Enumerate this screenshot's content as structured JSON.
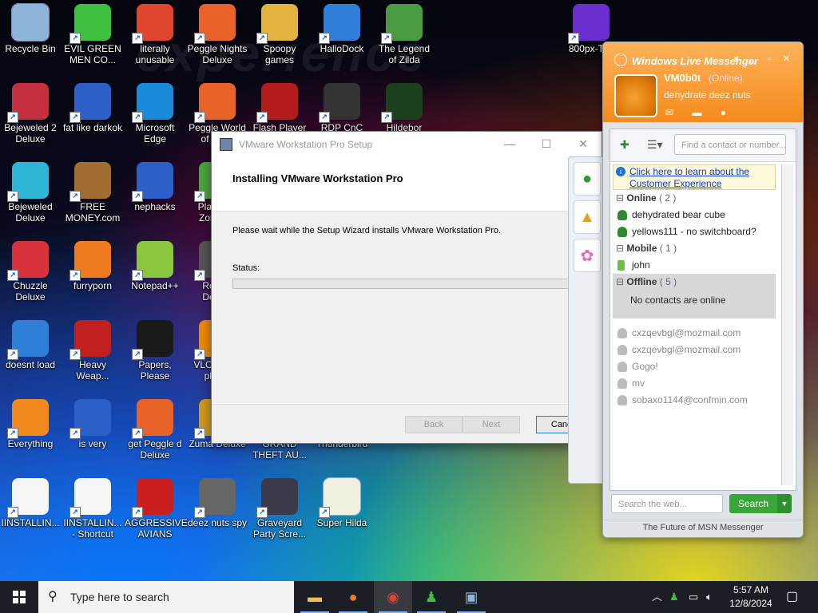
{
  "desktop": {
    "watermark": "experience",
    "icons": [
      {
        "label": "Recycle Bin",
        "icon": "recycle-bin-icon",
        "color": "#8fb4d9",
        "selected": true
      },
      {
        "label": "EVIL GREEN MEN CO...",
        "icon": "msn-buddies-icon",
        "color": "#3fbf3f"
      },
      {
        "label": "literally unusable",
        "icon": "chrome-icon",
        "color": "#e0452d"
      },
      {
        "label": "Peggle Nights Deluxe",
        "icon": "peggle-icon",
        "color": "#e8622a"
      },
      {
        "label": "Spoopy games",
        "icon": "folder-icon",
        "color": "#e4b23f"
      },
      {
        "label": "HalloDock",
        "icon": "shield-icon",
        "color": "#2f7fd8"
      },
      {
        "label": "The Legend of Zilda",
        "icon": "game-character-icon",
        "color": "#4a9a42"
      },
      {
        "label": "800px-Ti...",
        "icon": "image-file-icon",
        "color": "#6b2fd0"
      },
      {
        "label": "Bejeweled 2 Deluxe",
        "icon": "bejeweled-icon",
        "color": "#c4303d"
      },
      {
        "label": "fat like darkok",
        "icon": "mpi-icon",
        "color": "#2d5fc9"
      },
      {
        "label": "Microsoft Edge",
        "icon": "edge-icon",
        "color": "#1a8bd9"
      },
      {
        "label": "Peggle World of Wa...",
        "icon": "peggle-icon",
        "color": "#e8622a"
      },
      {
        "label": "Flash Player",
        "icon": "flash-icon",
        "color": "#b31c1c"
      },
      {
        "label": "RDP CnC",
        "icon": "remote-desktop-icon",
        "color": "#333333"
      },
      {
        "label": "Hildebor",
        "icon": "yashma-icon",
        "color": "#1c3f1c"
      },
      {
        "label": "Bejeweled Deluxe",
        "icon": "gem-icon",
        "color": "#2fb6d6"
      },
      {
        "label": "FREE MONEY.com",
        "icon": "money-bag-icon",
        "color": "#a06c2f"
      },
      {
        "label": "nephacks",
        "icon": "mpi-icon",
        "color": "#2d5fc9"
      },
      {
        "label": "Plants vs Zombies",
        "icon": "plant-icon",
        "color": "#4aa83a"
      },
      {
        "label": "Chuzzle Deluxe",
        "icon": "chuzzle-icon",
        "color": "#d8323a"
      },
      {
        "label": "furryporn",
        "icon": "firefox-icon",
        "color": "#f07a1e"
      },
      {
        "label": "Notepad++",
        "icon": "notepad-icon",
        "color": "#8cc63f"
      },
      {
        "label": "Rocket Deluxe",
        "icon": "rocket-icon",
        "color": "#555555"
      },
      {
        "label": "doesnt load",
        "icon": "thunderbird-icon",
        "color": "#2f7fd8"
      },
      {
        "label": "Heavy Weap...",
        "icon": "radiation-icon",
        "color": "#c21f1f"
      },
      {
        "label": "Papers, Please",
        "icon": "papers-please-icon",
        "color": "#1a1a1a"
      },
      {
        "label": "VLC media player",
        "icon": "vlc-icon",
        "color": "#f08a00"
      },
      {
        "label": "Everything",
        "icon": "search-ring-icon",
        "color": "#f08a1e"
      },
      {
        "label": "is very",
        "icon": "mpi-icon",
        "color": "#2d5fc9"
      },
      {
        "label": "get Peggle d Deluxe",
        "icon": "peggle-icon",
        "color": "#e8622a"
      },
      {
        "label": "Zuma Deluxe",
        "icon": "zuma-icon",
        "color": "#d39a1e"
      },
      {
        "label": "GRAND THEFT AU...",
        "icon": "gta-icon",
        "color": "#222222"
      },
      {
        "label": "Thunderbird",
        "icon": "thunderbird-icon",
        "color": "#2f7fd8"
      },
      {
        "label": "IINSTALLIN...",
        "icon": "text-file-icon",
        "color": "#f5f5f5"
      },
      {
        "label": "IINSTALLIN... - Shortcut",
        "icon": "text-file-icon",
        "color": "#f5f5f5"
      },
      {
        "label": "AGGRESSIVE AVIANS",
        "icon": "angry-bird-icon",
        "color": "#c91f1f"
      },
      {
        "label": "deez nuts spy",
        "icon": "stacked-windows-icon",
        "color": "#666666"
      },
      {
        "label": "Graveyard Party Scre...",
        "icon": "graveyard-icon",
        "color": "#3a3a4a"
      },
      {
        "label": "Super Hilda",
        "icon": "pixel-art-icon",
        "color": "#f0f0e0",
        "selected": true
      }
    ]
  },
  "setup": {
    "title": "VMware Workstation Pro Setup",
    "heading": "Installing VMware Workstation Pro",
    "message": "Please wait while the Setup Wizard installs VMware Workstation Pro.",
    "status_label": "Status:",
    "progress": 0,
    "buttons": {
      "back": "Back",
      "next": "Next",
      "cancel": "Cancel"
    },
    "window_controls": {
      "minimize": "—",
      "maximize": "☐",
      "close": "✕"
    }
  },
  "msn": {
    "brand": "Windows Live Messenger",
    "user": {
      "name": "VM0b0t",
      "status": "(Online)",
      "personal_message": "dehydrate deez nuts"
    },
    "search_contacts_placeholder": "Find a contact or number...",
    "banner": "Click here to learn about the Customer Experience",
    "groups": {
      "online": {
        "label": "Online",
        "count": "( 2 )",
        "contacts": [
          "dehydrated bear cube",
          "yellows111 - no switchboard?"
        ]
      },
      "mobile": {
        "label": "Mobile",
        "count": "( 1 )",
        "contacts": [
          "john"
        ]
      },
      "offline": {
        "label": "Offline",
        "count": "( 5 )",
        "empty_text": "No contacts are online",
        "contacts": [
          "cxzqevbgl@mozmail.com",
          "cxzqevbgl@mozmail.com",
          "Gogo!",
          "mv",
          "sobaxo1144@confmin.com"
        ]
      }
    },
    "web_search_placeholder": "Search the web...",
    "search_button": "Search",
    "footer": "The Future of MSN Messenger"
  },
  "taskbar": {
    "search_placeholder": "Type here to search",
    "apps": [
      "file-explorer-icon",
      "firefox-icon",
      "chrome-icon",
      "msn-buddies-icon",
      "setup-installer-icon"
    ],
    "time": "5:57 AM",
    "date": "12/8/2024"
  }
}
